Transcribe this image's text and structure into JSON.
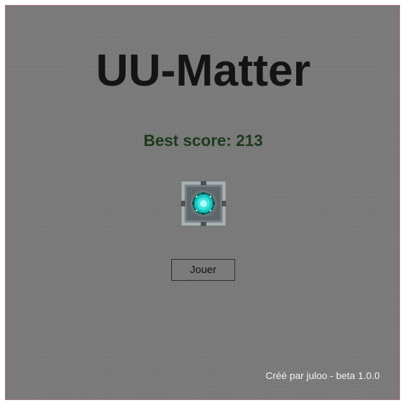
{
  "game": {
    "title": "UU-Matter",
    "best_score_label": "Best score: 213",
    "best_score": 213,
    "icon": "uu-matter-block-icon",
    "play_label": "Jouer",
    "credits": "Créé par juloo - beta 1.0.0"
  },
  "colors": {
    "background": "#7b7b7b",
    "frame_border": "#b07a82",
    "title": "#141414",
    "best_score": "#1c3a1c",
    "credits": "#f2f2f2",
    "icon_core": "#18c8c0"
  }
}
